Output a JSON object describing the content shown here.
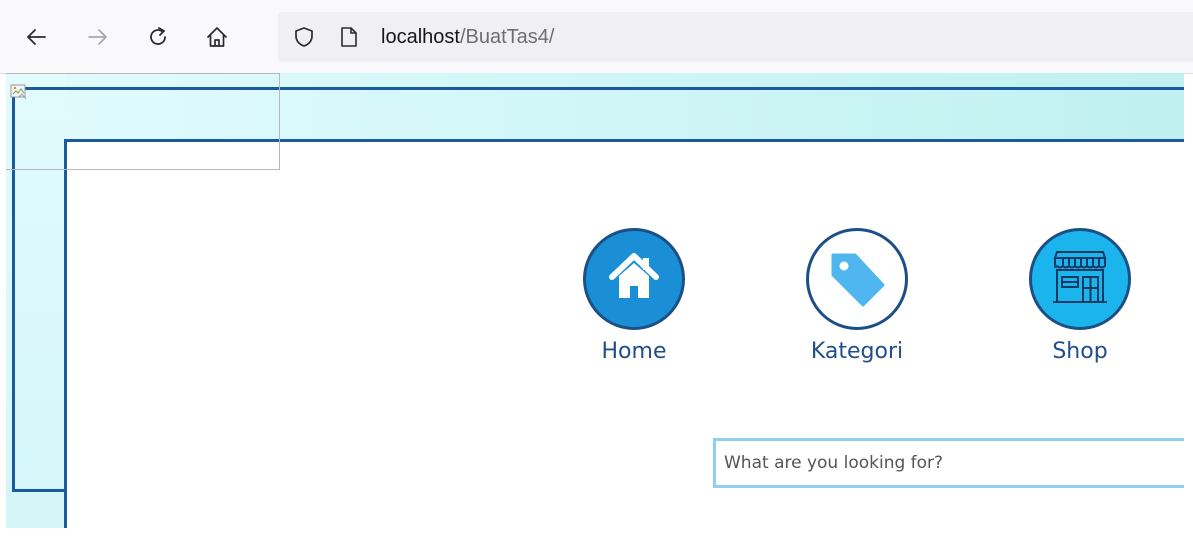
{
  "browser": {
    "url_host": "localhost",
    "url_path": "/BuatTas4/",
    "icons": [
      "back-arrow-icon",
      "forward-arrow-icon",
      "reload-icon",
      "home-icon",
      "shield-icon",
      "page-icon"
    ]
  },
  "page": {
    "nav": [
      {
        "label": "Home",
        "icon": "house-icon"
      },
      {
        "label": "Kategori",
        "icon": "tag-icon"
      },
      {
        "label": "Shop",
        "icon": "storefront-icon"
      }
    ],
    "search": {
      "placeholder": "What are you looking for?",
      "value": ""
    },
    "colors": {
      "line": "#1b5a9c",
      "home_circle": "#1a8fd6",
      "kategori_tag": "#4fb6f0",
      "shop_circle": "#1cb4ec",
      "label": "#1f4f8a",
      "search_border": "#8fcff2"
    }
  }
}
